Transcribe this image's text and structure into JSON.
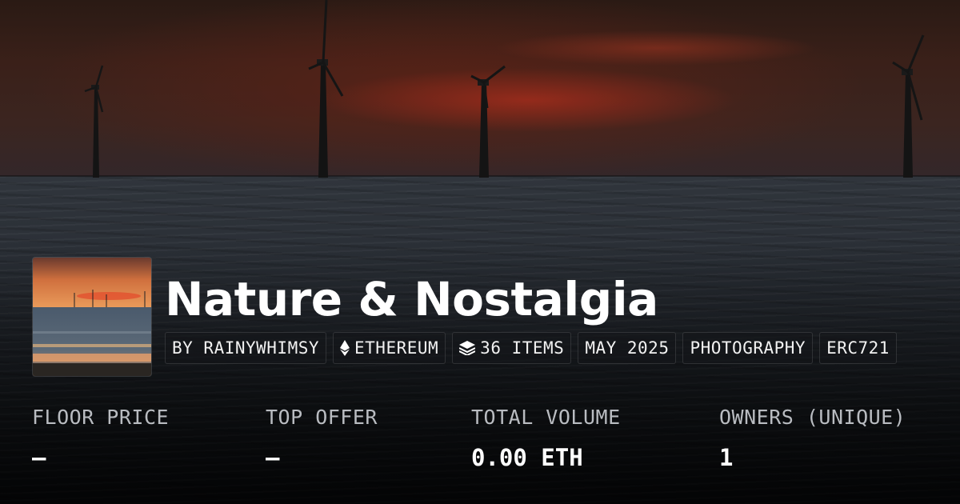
{
  "collection": {
    "name": "Nature & Nostalgia",
    "tags": [
      {
        "label": "BY RAINYWHIMSY",
        "icon": ""
      },
      {
        "label": "ETHEREUM",
        "icon": "ethereum-icon"
      },
      {
        "label": "36 ITEMS",
        "icon": "layers-icon"
      },
      {
        "label": "MAY 2025",
        "icon": ""
      },
      {
        "label": "PHOTOGRAPHY",
        "icon": ""
      },
      {
        "label": "ERC721",
        "icon": ""
      }
    ]
  },
  "stats": [
    {
      "label": "FLOOR PRICE",
      "value": "—"
    },
    {
      "label": "TOP OFFER",
      "value": "—"
    },
    {
      "label": "TOTAL VOLUME",
      "value": "0.00 ETH"
    },
    {
      "label": "OWNERS (UNIQUE)",
      "value": "1"
    }
  ],
  "colors": {
    "text": "#ffffff",
    "label": "#b9bcc1",
    "sunset": "#c0422c"
  }
}
